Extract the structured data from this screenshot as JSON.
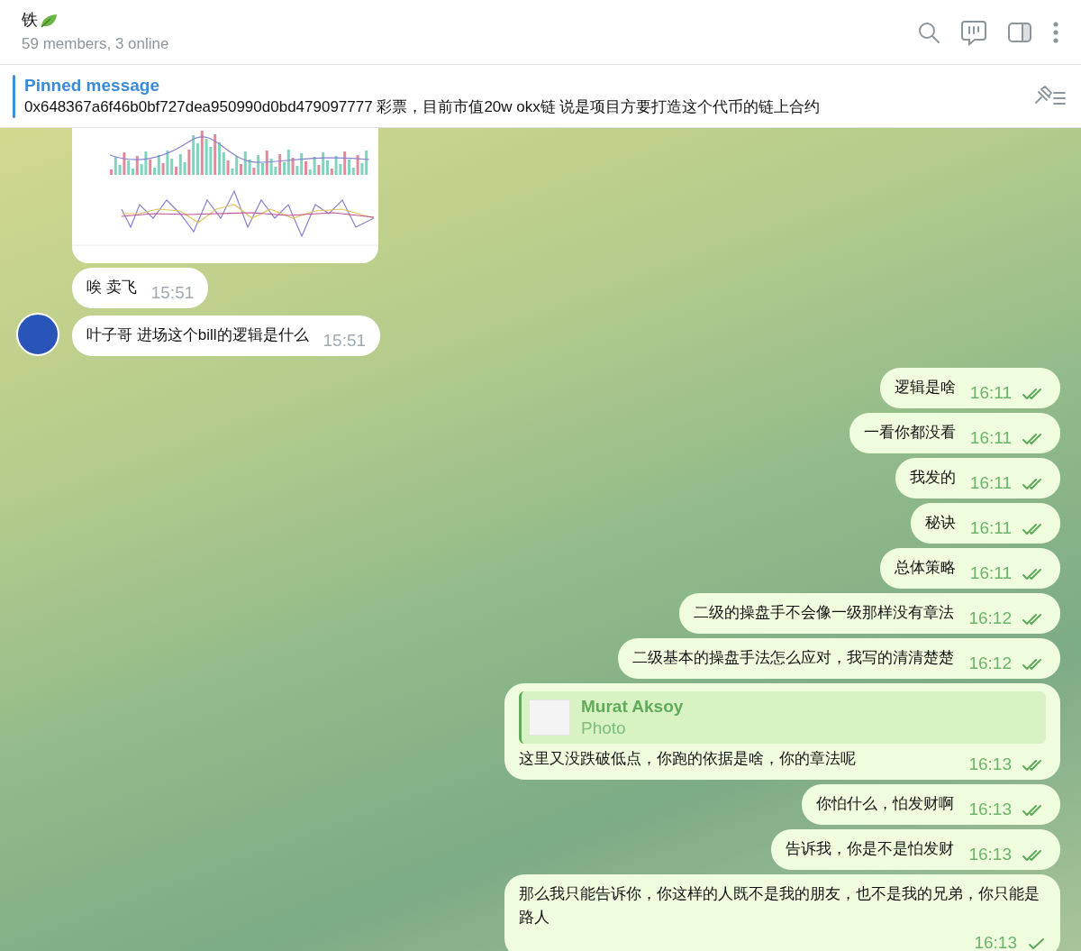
{
  "chat": {
    "title": "铁",
    "subtitle": "59 members, 3 online"
  },
  "pinned": {
    "label": "Pinned message",
    "text": "0x648367a6f46b0bf727dea950990d0bd479097777 彩票，目前市值20w okx链 说是项目方要打造这个代币的链上合约"
  },
  "messages": [
    {
      "kind": "photo",
      "outgoing": false
    },
    {
      "kind": "text",
      "outgoing": false,
      "avatar": false,
      "text": "唉 卖飞",
      "time": "15:51"
    },
    {
      "kind": "text",
      "outgoing": false,
      "avatar": true,
      "text": "叶子哥 进场这个bill的逻辑是什么",
      "time": "15:51"
    },
    {
      "kind": "text",
      "outgoing": true,
      "text": "逻辑是啥",
      "time": "16:11",
      "read": true
    },
    {
      "kind": "text",
      "outgoing": true,
      "text": "一看你都没看",
      "time": "16:11",
      "read": true
    },
    {
      "kind": "text",
      "outgoing": true,
      "text": "我发的",
      "time": "16:11",
      "read": true
    },
    {
      "kind": "text",
      "outgoing": true,
      "text": "秘诀",
      "time": "16:11",
      "read": true
    },
    {
      "kind": "text",
      "outgoing": true,
      "text": "总体策略",
      "time": "16:11",
      "read": true
    },
    {
      "kind": "text",
      "outgoing": true,
      "text": "二级的操盘手不会像一级那样没有章法",
      "time": "16:12",
      "read": true
    },
    {
      "kind": "text",
      "outgoing": true,
      "text": "二级基本的操盘手法怎么应对，我写的清清楚楚",
      "time": "16:12",
      "read": true
    },
    {
      "kind": "reply",
      "outgoing": true,
      "reply": {
        "author": "Murat Aksoy",
        "preview": "Photo"
      },
      "text": "这里又没跌破低点，你跑的依据是啥，你的章法呢",
      "time": "16:13",
      "read": true
    },
    {
      "kind": "text",
      "outgoing": true,
      "text": "你怕什么，怕发财啊",
      "time": "16:13",
      "read": true
    },
    {
      "kind": "text",
      "outgoing": true,
      "text": "告诉我，你是不是怕发财",
      "time": "16:13",
      "read": true
    },
    {
      "kind": "text",
      "outgoing": true,
      "text": "那么我只能告诉你，你这样的人既不是我的朋友，也不是我的兄弟，你只能是路人",
      "time": "16:13",
      "read": false
    }
  ]
}
